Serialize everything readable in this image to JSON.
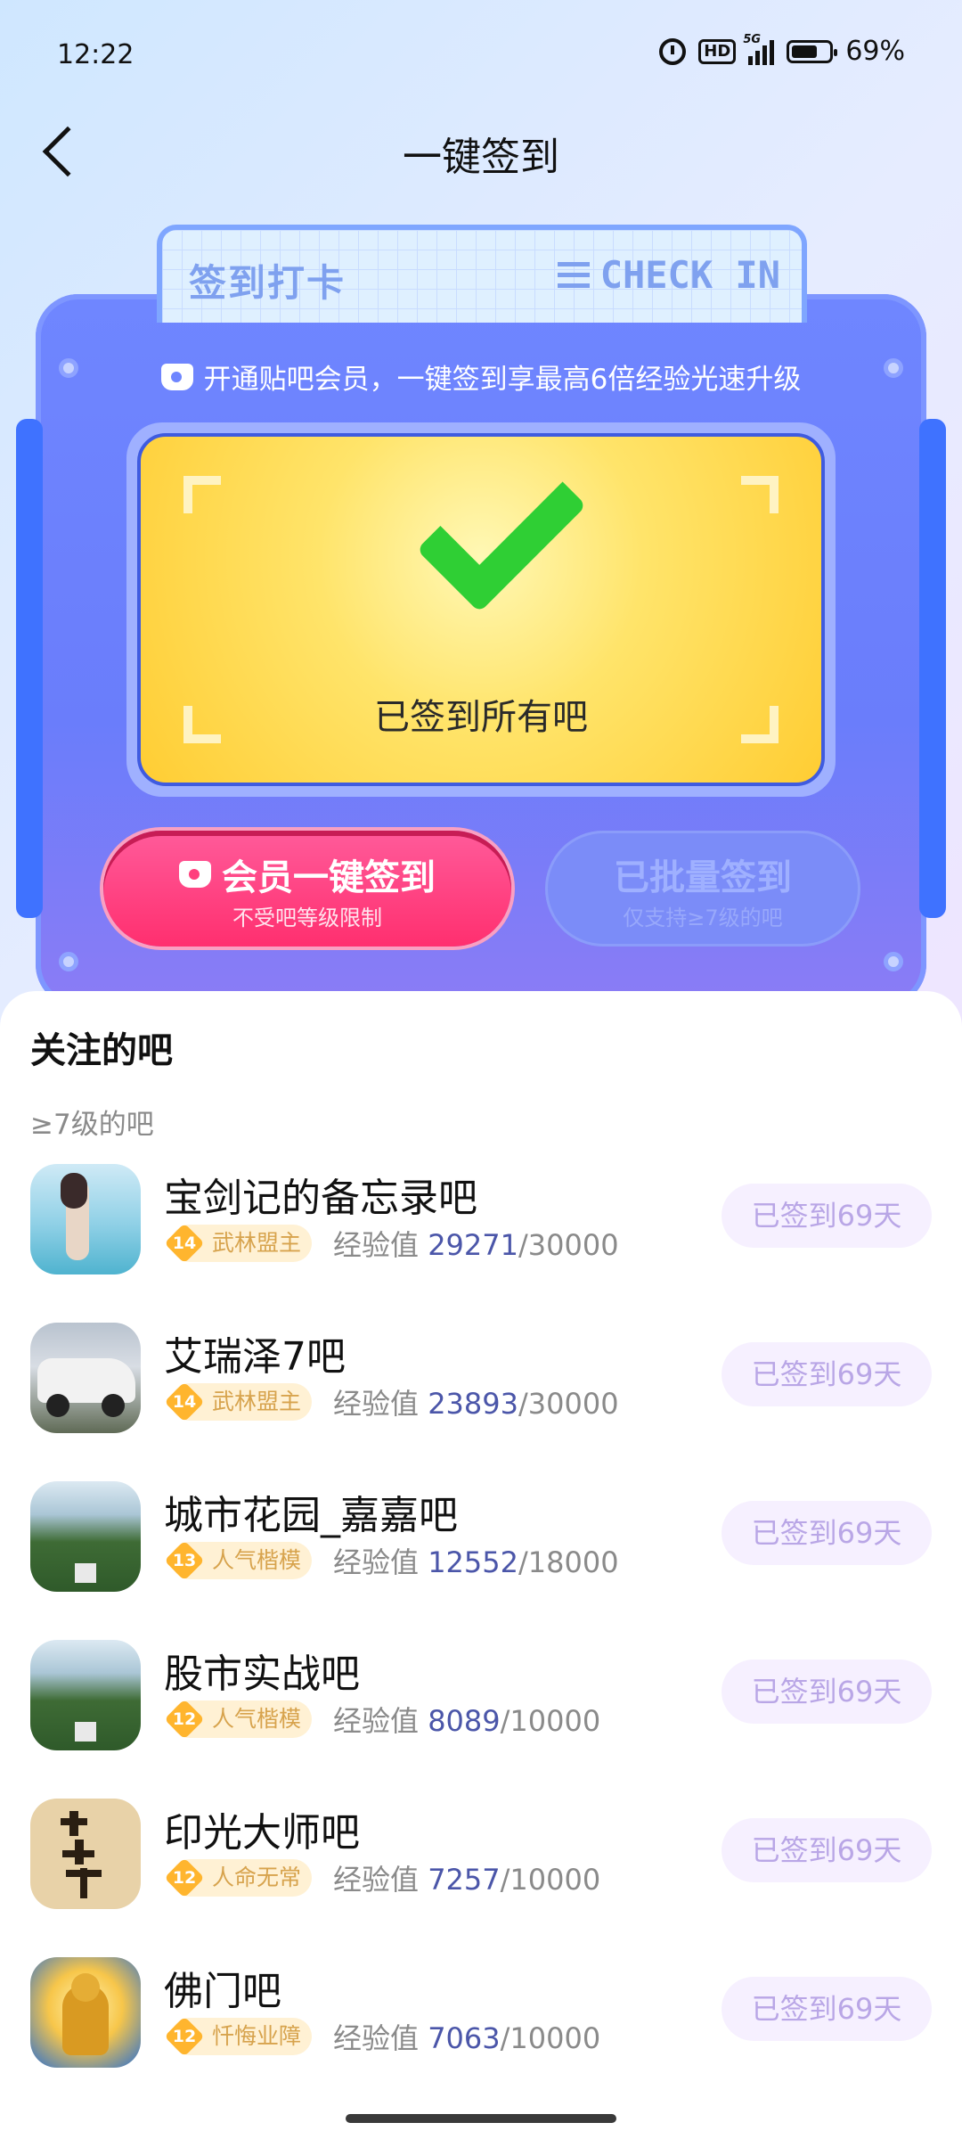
{
  "status_bar": {
    "time": "12:22",
    "network": "5G",
    "hd": "HD",
    "battery": "69%"
  },
  "header": {
    "title": "一键签到"
  },
  "board": {
    "tab_left": "签到打卡",
    "tab_right": "CHECK IN",
    "promo": "开通贴吧会员，一键签到享最高6倍经验光速升级",
    "status_text": "已签到所有吧",
    "vip_button": {
      "label": "会员一键签到",
      "sub": "不受吧等级限制"
    },
    "batch_button": {
      "label": "已批量签到",
      "sub": "仅支持≥7级的吧"
    }
  },
  "list": {
    "title": "关注的吧",
    "subtitle": "≥7级的吧",
    "items": [
      {
        "name": "宝剑记的备忘录吧",
        "level": "14",
        "title": "武林盟主",
        "exp_label": "经验值",
        "exp_current": "29271",
        "exp_total": "/30000",
        "action": "已签到69天"
      },
      {
        "name": "艾瑞泽7吧",
        "level": "14",
        "title": "武林盟主",
        "exp_label": "经验值",
        "exp_current": "23893",
        "exp_total": "/30000",
        "action": "已签到69天"
      },
      {
        "name": "城市花园_嘉嘉吧",
        "level": "13",
        "title": "人气楷模",
        "exp_label": "经验值",
        "exp_current": "12552",
        "exp_total": "/18000",
        "action": "已签到69天"
      },
      {
        "name": "股市实战吧",
        "level": "12",
        "title": "人气楷模",
        "exp_label": "经验值",
        "exp_current": "8089",
        "exp_total": "/10000",
        "action": "已签到69天"
      },
      {
        "name": "印光大师吧",
        "level": "12",
        "title": "人命无常",
        "exp_label": "经验值",
        "exp_current": "7257",
        "exp_total": "/10000",
        "action": "已签到69天"
      },
      {
        "name": "佛门吧",
        "level": "12",
        "title": "忏悔业障",
        "exp_label": "经验值",
        "exp_current": "7063",
        "exp_total": "/10000",
        "action": "已签到69天"
      }
    ]
  }
}
